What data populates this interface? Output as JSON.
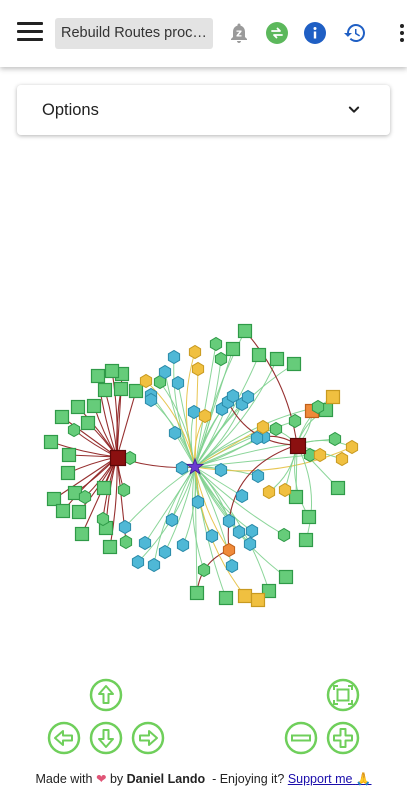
{
  "header": {
    "search_value": "Rebuild Routes process",
    "icons": [
      "menu-icon",
      "notification-snooze-icon",
      "sync-icon",
      "info-icon",
      "history-icon",
      "more-vert-icon"
    ],
    "colors": {
      "sync": "#5cb85c",
      "info": "#1f5fc4",
      "history": "#1f5fc4"
    }
  },
  "options": {
    "label": "Options"
  },
  "graph": {
    "colors": {
      "square_node": "#66cc7a",
      "square_stroke": "#2f9a48",
      "hex_blue": "#4fb8d6",
      "hex_green": "#66cc7a",
      "hex_yellow": "#f0c040",
      "hub": "#8b1010",
      "star": "#6a3ad0",
      "orange": "#ef8a3a",
      "edge_green": "#7ed08e",
      "edge_red": "#8b1a1a",
      "edge_yellow": "#e6c040"
    }
  },
  "controls": {
    "icons": [
      "arrow-up-icon",
      "arrow-left-icon",
      "arrow-down-icon",
      "arrow-right-icon",
      "fit-screen-icon",
      "zoom-out-icon",
      "zoom-in-icon"
    ],
    "color": "#6fcf5b"
  },
  "footer": {
    "made_with": "Made with",
    "heart": "❤",
    "by": "by",
    "author": "Daniel Lando",
    "enjoying": "- Enjoying it?",
    "support": "Support me",
    "support_emoji": "🙏"
  }
}
